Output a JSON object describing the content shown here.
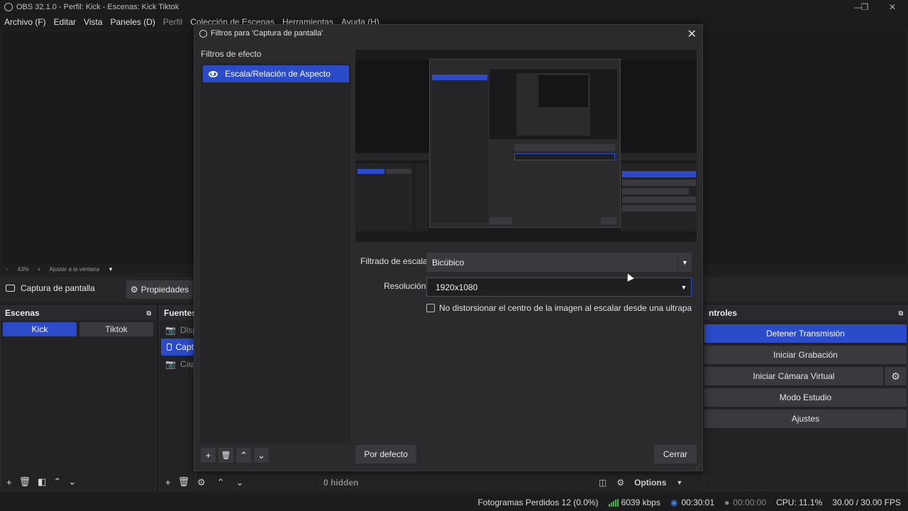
{
  "window": {
    "title": "OBS 32.1.0 - Perfil: Kick - Escenas: Kick Tiktok"
  },
  "menu": [
    "Archivo (F)",
    "Editar",
    "Vista",
    "Paneles (D)",
    "Perfil",
    "Colección de Escenas",
    "Herramientas",
    "Ayuda (H)"
  ],
  "zoom": {
    "minus": "−",
    "value": "43%",
    "plus": "+",
    "fit": "Ajustar a la ventana"
  },
  "source_bar": {
    "name": "Captura de pantalla",
    "properties": "Propiedades"
  },
  "scenes": {
    "title": "Escenas",
    "items": [
      "Kick",
      "Tiktok"
    ]
  },
  "sources": {
    "title": "Fuentes",
    "items": [
      "Disp",
      "Capt",
      "Capt"
    ]
  },
  "mixer": {
    "hidden": "0 hidden",
    "options": "Options"
  },
  "controls": {
    "title": "ntroles",
    "stop_stream": "Detener Transmisión",
    "start_record": "Iniciar Grabación",
    "virtual_cam": "Iniciar Cámara Virtual",
    "studio": "Modo Estudio",
    "settings": "Ajustes"
  },
  "status": {
    "dropped": "Fotogramas Perdidos 12 (0.0%)",
    "kbps": "6039 kbps",
    "stream_time": "00:30:01",
    "rec_time": "00:00:00",
    "cpu": "CPU: 11.1%",
    "fps": "30.00 / 30.00 FPS"
  },
  "dialog": {
    "title": "Filtros para 'Captura de pantalla'",
    "effects_header": "Filtros de efecto",
    "effect_item": "Escala/Relación de Aspecto",
    "scale_label": "Filtrado de escala",
    "scale_value": "Bicúbico",
    "res_label": "Resolución",
    "res_value": "1920x1080",
    "checkbox_label": "No distorsionar el centro de la imagen al escalar desde una ultrapanorámica",
    "default_button": "Por defecto",
    "close_button": "Cerrar"
  },
  "colors": {
    "accent": "#2b4bc9",
    "bg": "#1f1f22",
    "panel": "#232326",
    "button": "#3a3a3e"
  }
}
